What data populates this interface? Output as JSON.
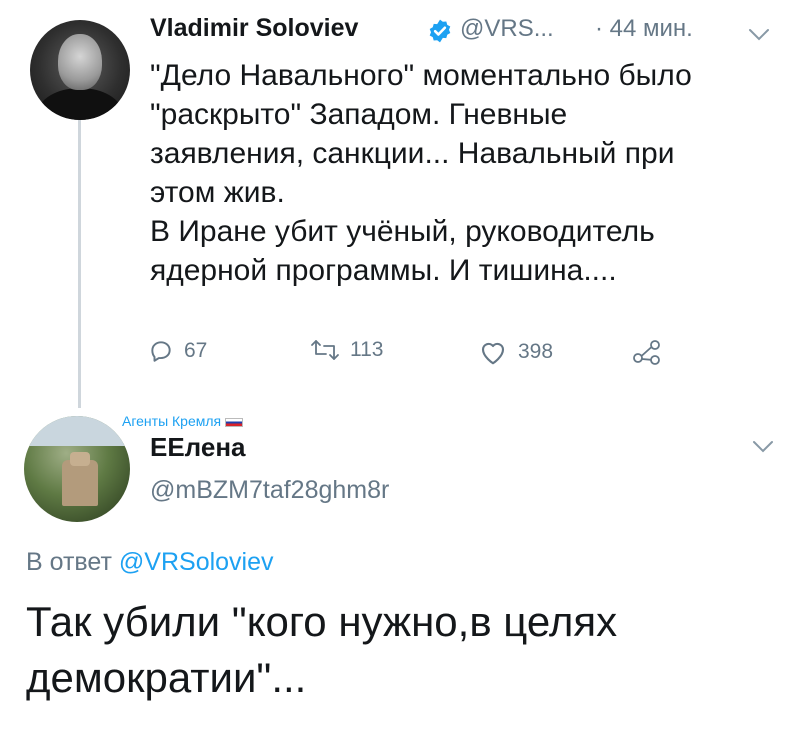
{
  "tweet": {
    "author_name": "Vladimir Soloviev",
    "author_handle": "@VRS...",
    "time": "· 44 мин.",
    "lines": [
      "\"Дело Навального\" моментально было",
      "\"раскрыто\" Западом. Гневные",
      "заявления, санкции... Навальный при",
      "этом жив.",
      "В Иране убит учёный, руководитель",
      "ядерной программы. И тишина...."
    ],
    "replies": "67",
    "retweets": "113",
    "likes": "398"
  },
  "reply": {
    "community_label": "Агенты Кремля",
    "author_name": "ЕЕлена",
    "author_handle": "@mBZM7taf28ghm8r",
    "reply_prefix": "В ответ",
    "reply_mention": "@VRSoloviev",
    "lines": [
      "Так убили \"кого нужно,в целях",
      "демократии\"..."
    ]
  },
  "colors": {
    "accent": "#1da1f2",
    "muted": "#657786",
    "text": "#14171a",
    "thread_line": "#cfd6dc"
  },
  "icons": [
    "verified-badge-icon",
    "chevron-down-icon",
    "reply-icon",
    "retweet-icon",
    "like-icon",
    "share-icon",
    "russian-flag-icon"
  ]
}
